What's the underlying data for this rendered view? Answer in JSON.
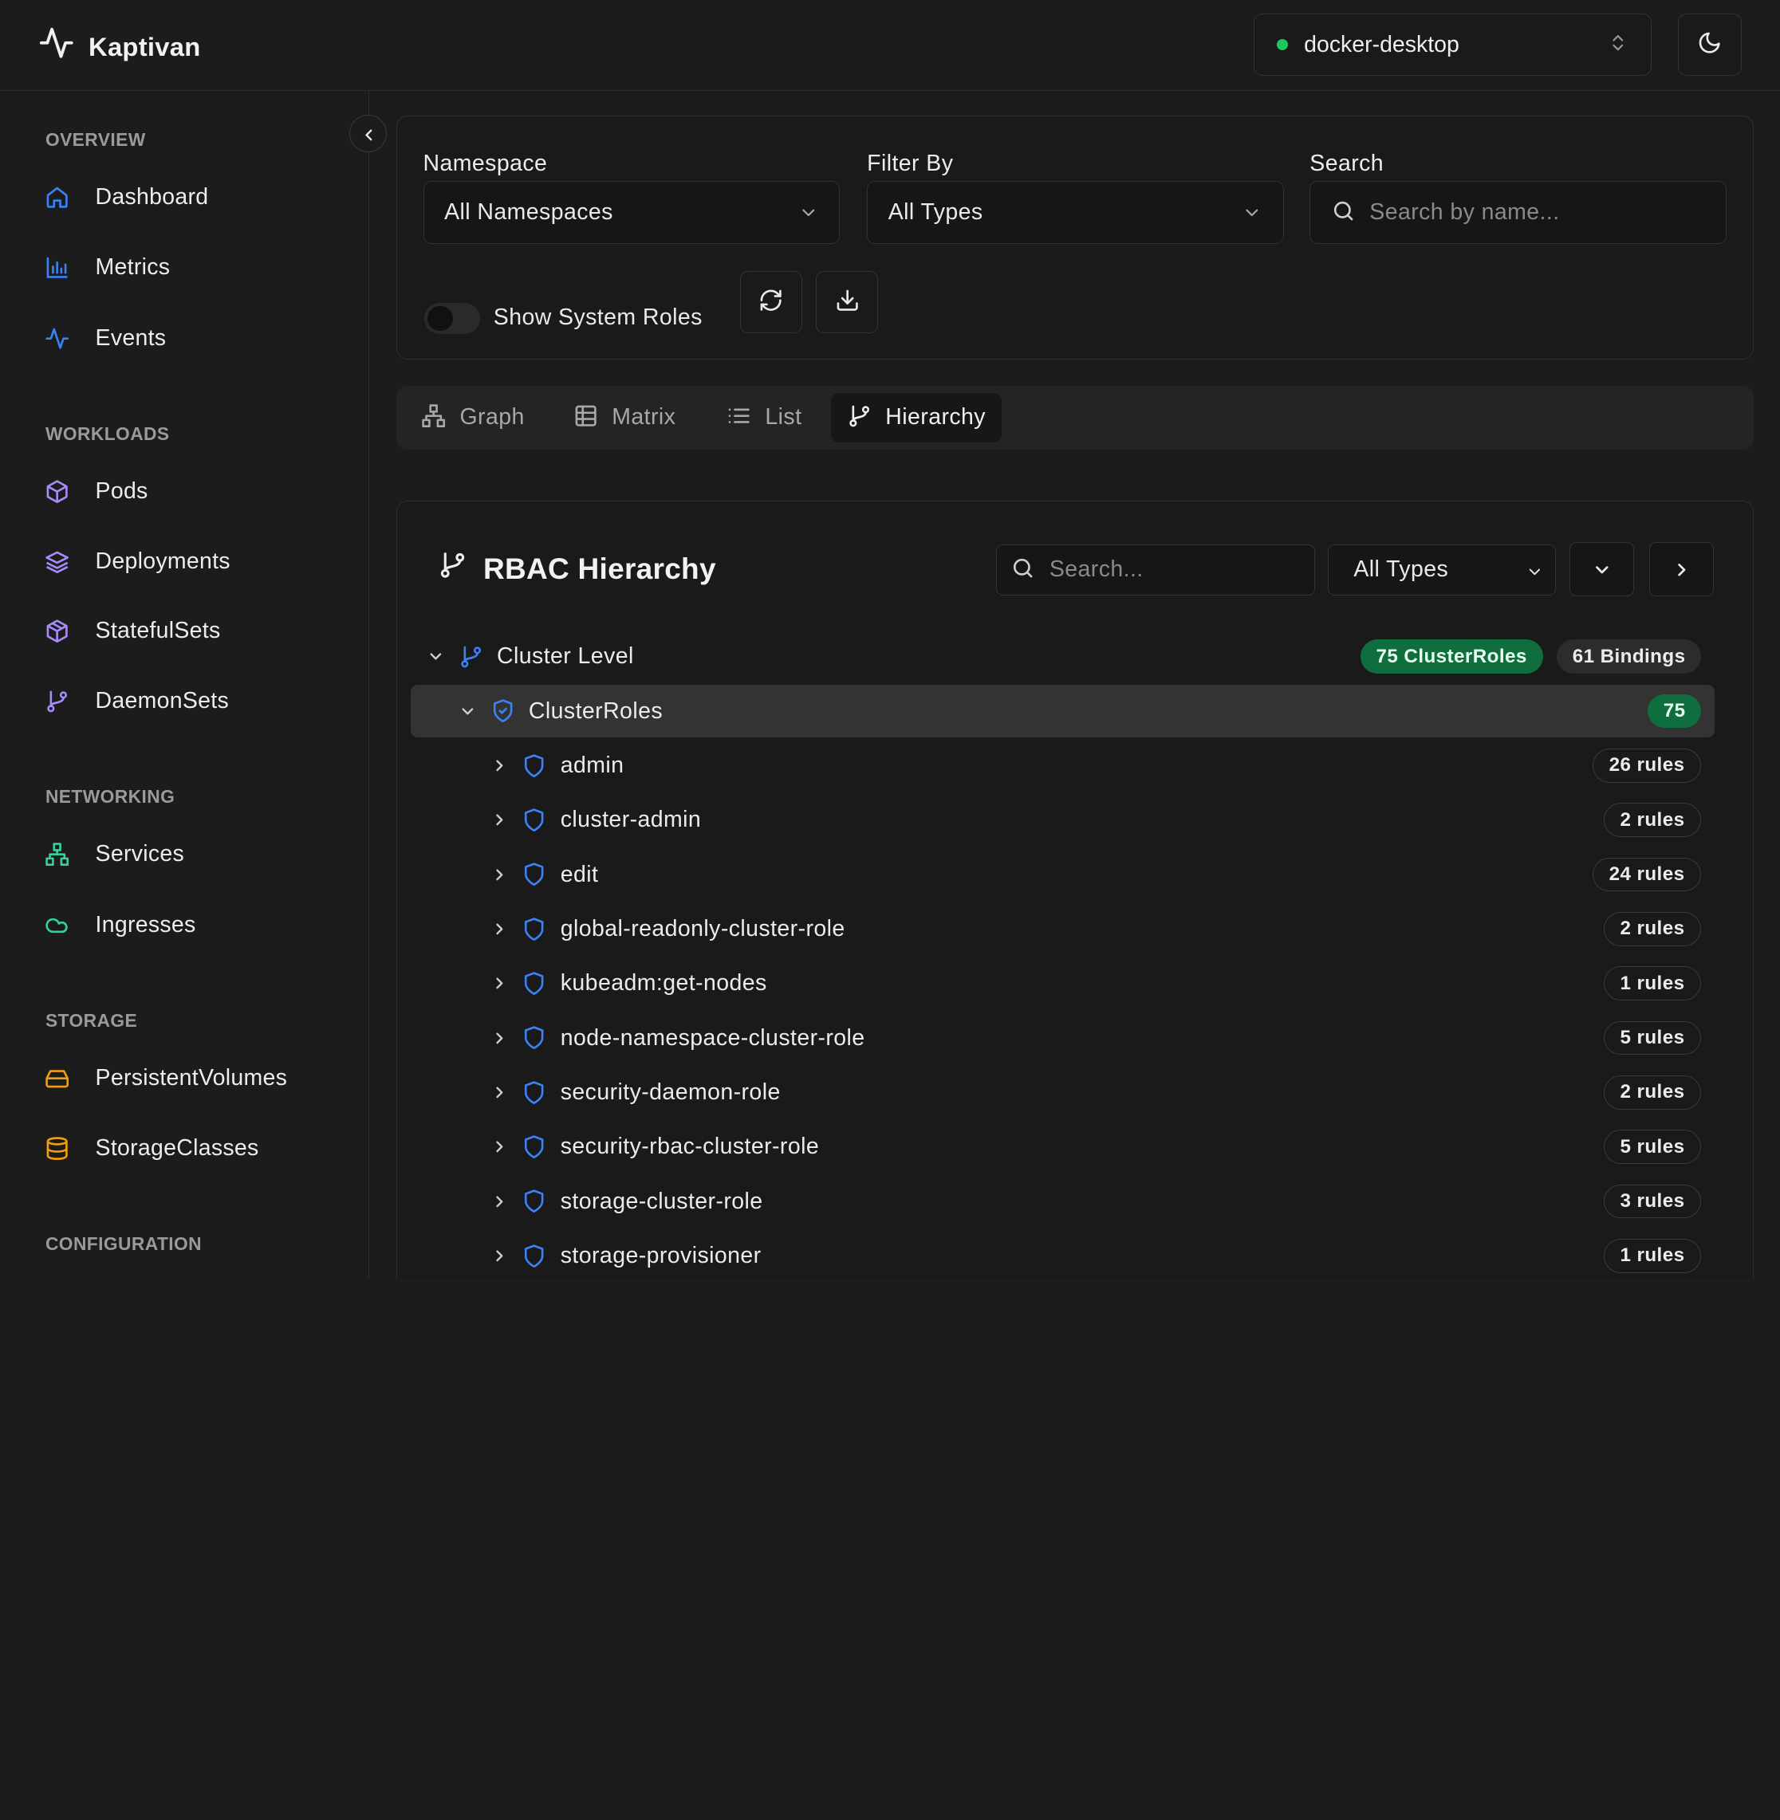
{
  "app": {
    "name": "Kaptivan"
  },
  "context": {
    "name": "docker-desktop",
    "status_color": "#22c55e"
  },
  "sidebar": {
    "sections": [
      {
        "title": "OVERVIEW",
        "items": [
          {
            "label": "Dashboard",
            "icon": "home-icon"
          },
          {
            "label": "Metrics",
            "icon": "bar-chart-icon"
          },
          {
            "label": "Events",
            "icon": "activity-icon"
          }
        ]
      },
      {
        "title": "WORKLOADS",
        "items": [
          {
            "label": "Pods",
            "icon": "box-icon"
          },
          {
            "label": "Deployments",
            "icon": "layers-icon"
          },
          {
            "label": "StatefulSets",
            "icon": "package-icon"
          },
          {
            "label": "DaemonSets",
            "icon": "git-branch-icon"
          }
        ]
      },
      {
        "title": "NETWORKING",
        "items": [
          {
            "label": "Services",
            "icon": "network-icon"
          },
          {
            "label": "Ingresses",
            "icon": "cloud-icon"
          }
        ]
      },
      {
        "title": "STORAGE",
        "items": [
          {
            "label": "PersistentVolumes",
            "icon": "hard-drive-icon"
          },
          {
            "label": "StorageClasses",
            "icon": "database-icon"
          }
        ]
      },
      {
        "title": "CONFIGURATION",
        "items": []
      }
    ]
  },
  "filters": {
    "namespace": {
      "label": "Namespace",
      "value": "All Namespaces"
    },
    "filter_by": {
      "label": "Filter By",
      "value": "All Types"
    },
    "search": {
      "label": "Search",
      "placeholder": "Search by name..."
    },
    "system_roles": {
      "label": "Show System Roles",
      "enabled": false
    }
  },
  "tabs": [
    {
      "label": "Graph",
      "icon": "sitemap-icon",
      "active": false
    },
    {
      "label": "Matrix",
      "icon": "table-icon",
      "active": false
    },
    {
      "label": "List",
      "icon": "list-icon",
      "active": false
    },
    {
      "label": "Hierarchy",
      "icon": "git-branch-icon",
      "active": true
    }
  ],
  "panel": {
    "title": "RBAC Hierarchy",
    "search_placeholder": "Search...",
    "type_select": "All Types",
    "cluster_level": {
      "label": "Cluster Level",
      "clusterroles_badge": "75 ClusterRoles",
      "bindings_badge": "61 Bindings"
    },
    "clusterroles": {
      "label": "ClusterRoles",
      "count": "75",
      "items": [
        {
          "name": "admin",
          "rules": "26 rules"
        },
        {
          "name": "cluster-admin",
          "rules": "2 rules"
        },
        {
          "name": "edit",
          "rules": "24 rules"
        },
        {
          "name": "global-readonly-cluster-role",
          "rules": "2 rules"
        },
        {
          "name": "kubeadm:get-nodes",
          "rules": "1 rules"
        },
        {
          "name": "node-namespace-cluster-role",
          "rules": "5 rules"
        },
        {
          "name": "security-daemon-role",
          "rules": "2 rules"
        },
        {
          "name": "security-rbac-cluster-role",
          "rules": "5 rules"
        },
        {
          "name": "storage-cluster-role",
          "rules": "3 rules"
        },
        {
          "name": "storage-provisioner",
          "rules": "1 rules"
        }
      ]
    }
  },
  "colors": {
    "blue_icon": "#3b82f6",
    "purple_icon": "#a78bfa",
    "green_icon": "#34d399",
    "orange_icon": "#f59e0b",
    "badge_green": "#0f6e3d"
  }
}
